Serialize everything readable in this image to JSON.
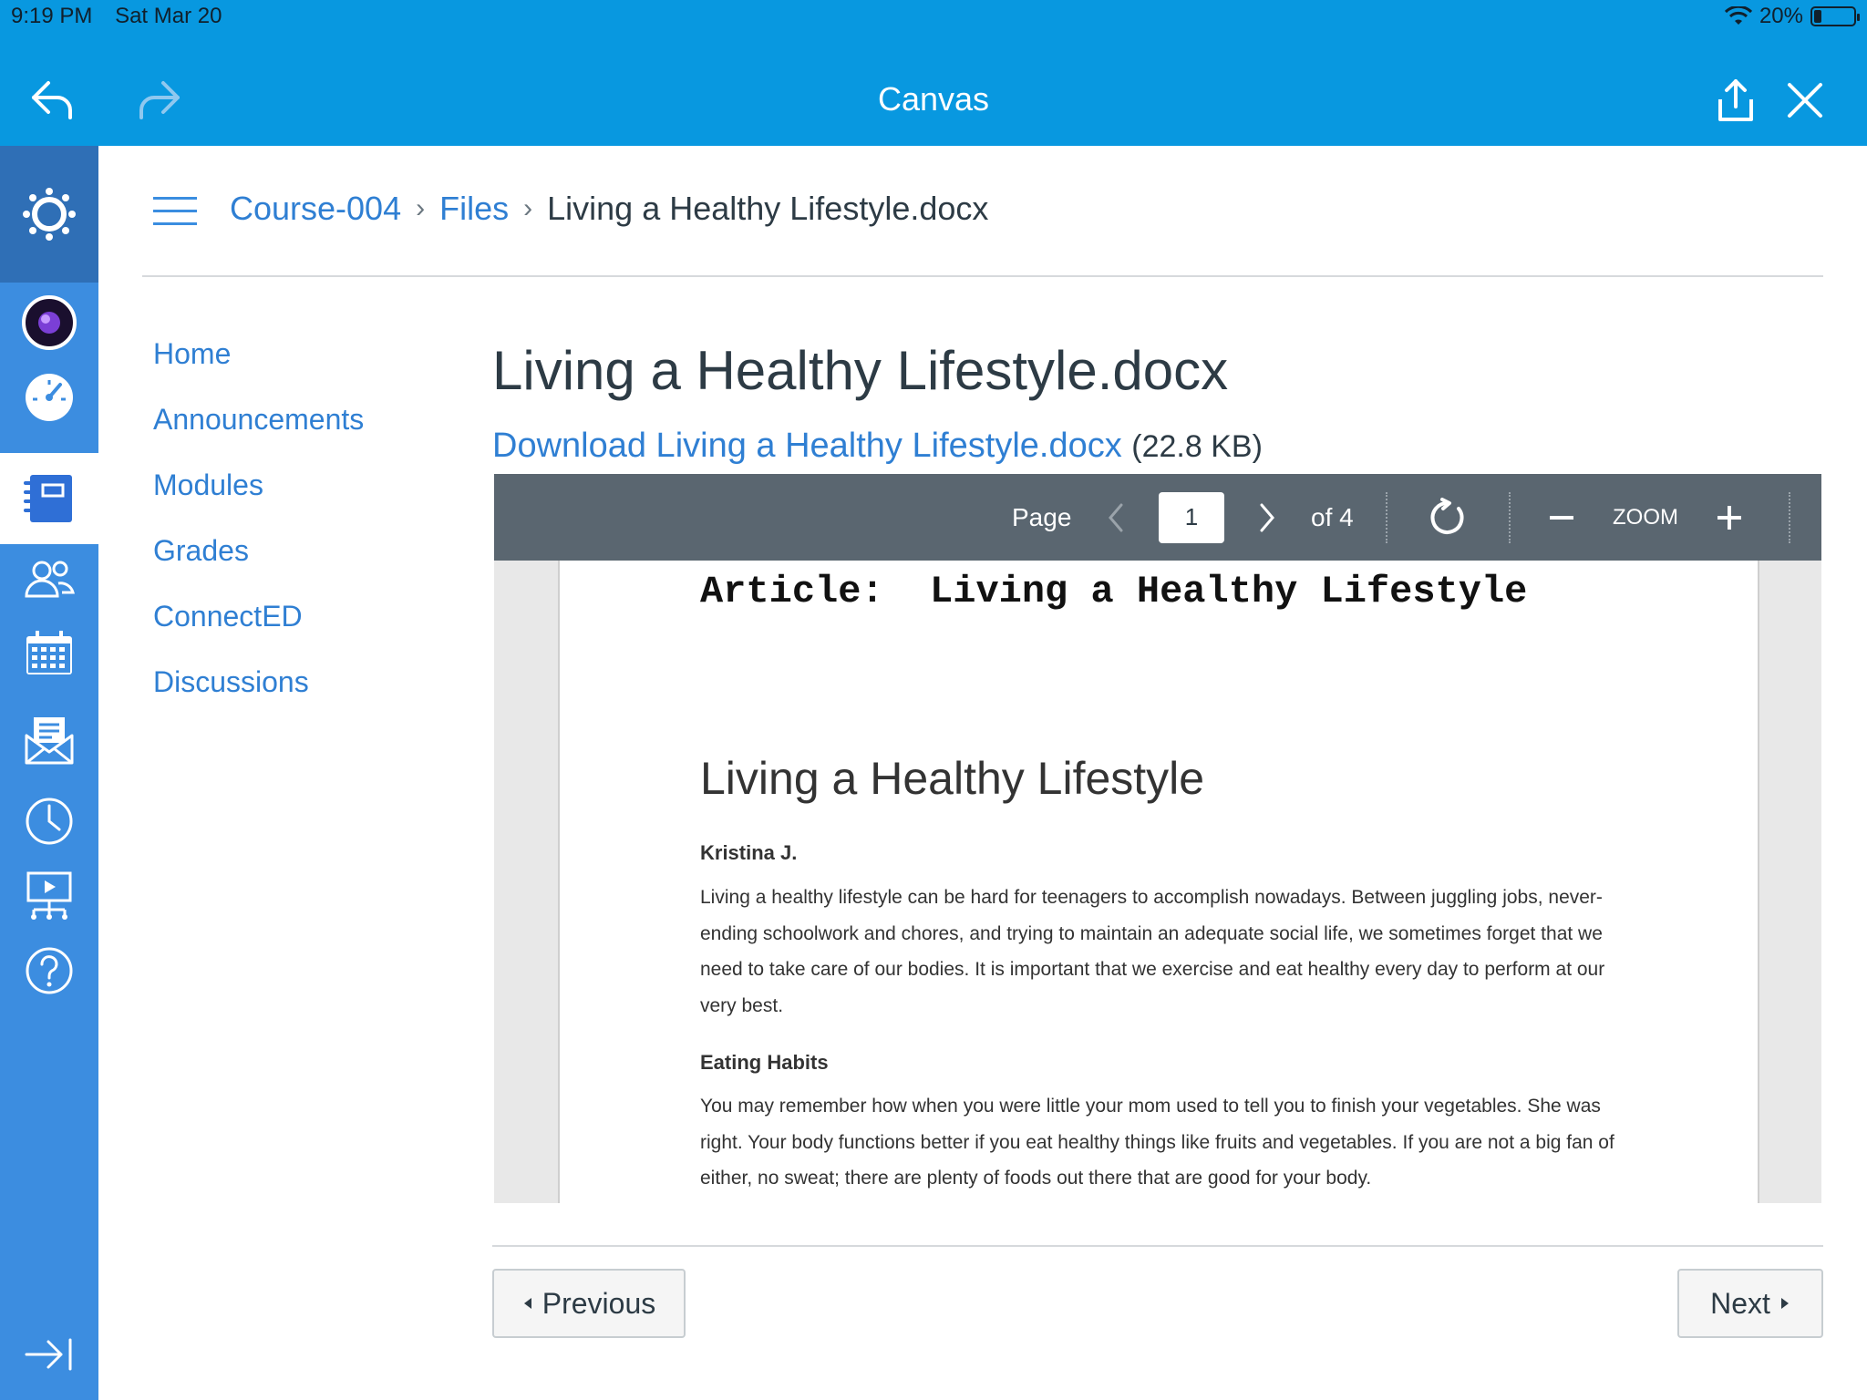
{
  "status_bar": {
    "time": "9:19 PM",
    "date": "Sat Mar 20",
    "battery": "20%"
  },
  "nav_bar": {
    "title": "Canvas"
  },
  "rail": {
    "items": [
      "canvas-logo-icon",
      "account-avatar",
      "dashboard-icon",
      "courses-icon",
      "groups-icon",
      "calendar-icon",
      "inbox-icon",
      "history-icon",
      "commons-icon",
      "help-icon",
      "collapse-icon"
    ]
  },
  "breadcrumb": {
    "items": [
      {
        "label": "Course-004",
        "link": true
      },
      {
        "label": "Files",
        "link": true
      },
      {
        "label": "Living a Healthy Lifestyle.docx",
        "link": false
      }
    ]
  },
  "course_nav": {
    "items": [
      "Home",
      "Announcements",
      "Modules",
      "Grades",
      "ConnectED",
      "Discussions"
    ]
  },
  "file": {
    "title": "Living a Healthy Lifestyle.docx",
    "download_label": "Download Living a Healthy Lifestyle.docx",
    "size": "(22.8 KB)"
  },
  "viewer": {
    "page_label": "Page",
    "current_page": "1",
    "of_pages": "of 4",
    "zoom_label": "ZOOM"
  },
  "document": {
    "article_title": "Article:  Living a Healthy Lifestyle",
    "heading": "Living a Healthy Lifestyle",
    "author": "Kristina J.",
    "paragraph1": "Living a healthy lifestyle can be hard for teenagers to accomplish nowadays. Between juggling jobs, never-ending schoolwork and chores, and trying to maintain an adequate social life, we sometimes forget that we need to take care of our bodies. It is important that we exercise and eat healthy every day to perform at our very best.",
    "subheading": "Eating Habits",
    "paragraph2": "You may remember how when you were little your mom used to tell you to finish your vegetables. She was right. Your body functions better if you eat healthy things like fruits and vegetables. If you are not a big fan of either, no sweat; there are plenty of foods out there that are good for your body."
  },
  "pager": {
    "previous": "Previous",
    "next": "Next"
  },
  "colors": {
    "accent": "#0898e0",
    "rail": "#3c8de0",
    "link": "#2f7fd3",
    "toolbar": "#5a6670"
  }
}
